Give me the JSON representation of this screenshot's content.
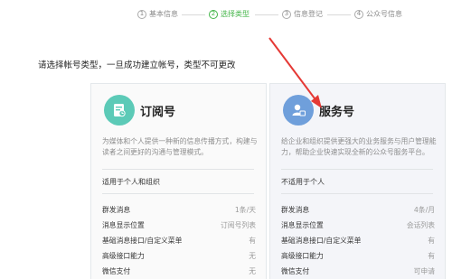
{
  "stepper": {
    "steps": [
      {
        "num": "1",
        "label": "基本信息"
      },
      {
        "num": "2",
        "label": "选择类型"
      },
      {
        "num": "3",
        "label": "信息登记"
      },
      {
        "num": "4",
        "label": "公众号信息"
      }
    ],
    "active_step": 2
  },
  "page": {
    "tip": "请选择帐号类型，一旦成功建立帐号，类型不可更改"
  },
  "cards": {
    "subscription": {
      "title": "订阅号",
      "description": "为媒体和个人提供一种新的信息传播方式，构建与读者之间更好的沟通与管理模式。",
      "suitable": "适用于个人和组织",
      "features": [
        {
          "label": "群发消息",
          "value": "1条/天"
        },
        {
          "label": "消息显示位置",
          "value": "订阅号列表"
        },
        {
          "label": "基础消息接口/自定义菜单",
          "value": "有"
        },
        {
          "label": "高级接口能力",
          "value": "无"
        },
        {
          "label": "微信支付",
          "value": "无"
        }
      ]
    },
    "service": {
      "title": "服务号",
      "description": "给企业和组织提供更强大的业务服务与用户管理能力，帮助企业快速实现全新的公众号服务平台。",
      "suitable": "不适用于个人",
      "features": [
        {
          "label": "群发消息",
          "value": "4条/月"
        },
        {
          "label": "消息显示位置",
          "value": "会话列表"
        },
        {
          "label": "基础消息接口/自定义菜单",
          "value": "有"
        },
        {
          "label": "高级接口能力",
          "value": "有"
        },
        {
          "label": "微信支付",
          "value": "可申请"
        }
      ]
    }
  },
  "colors": {
    "accent": "#44b549",
    "annotation_arrow": "#e53935",
    "subscription_icon_bg": "#5ccab7",
    "service_icon_bg": "#6f9fdb"
  },
  "icons": {
    "subscription": "document-chart-icon",
    "service": "user-card-icon"
  }
}
